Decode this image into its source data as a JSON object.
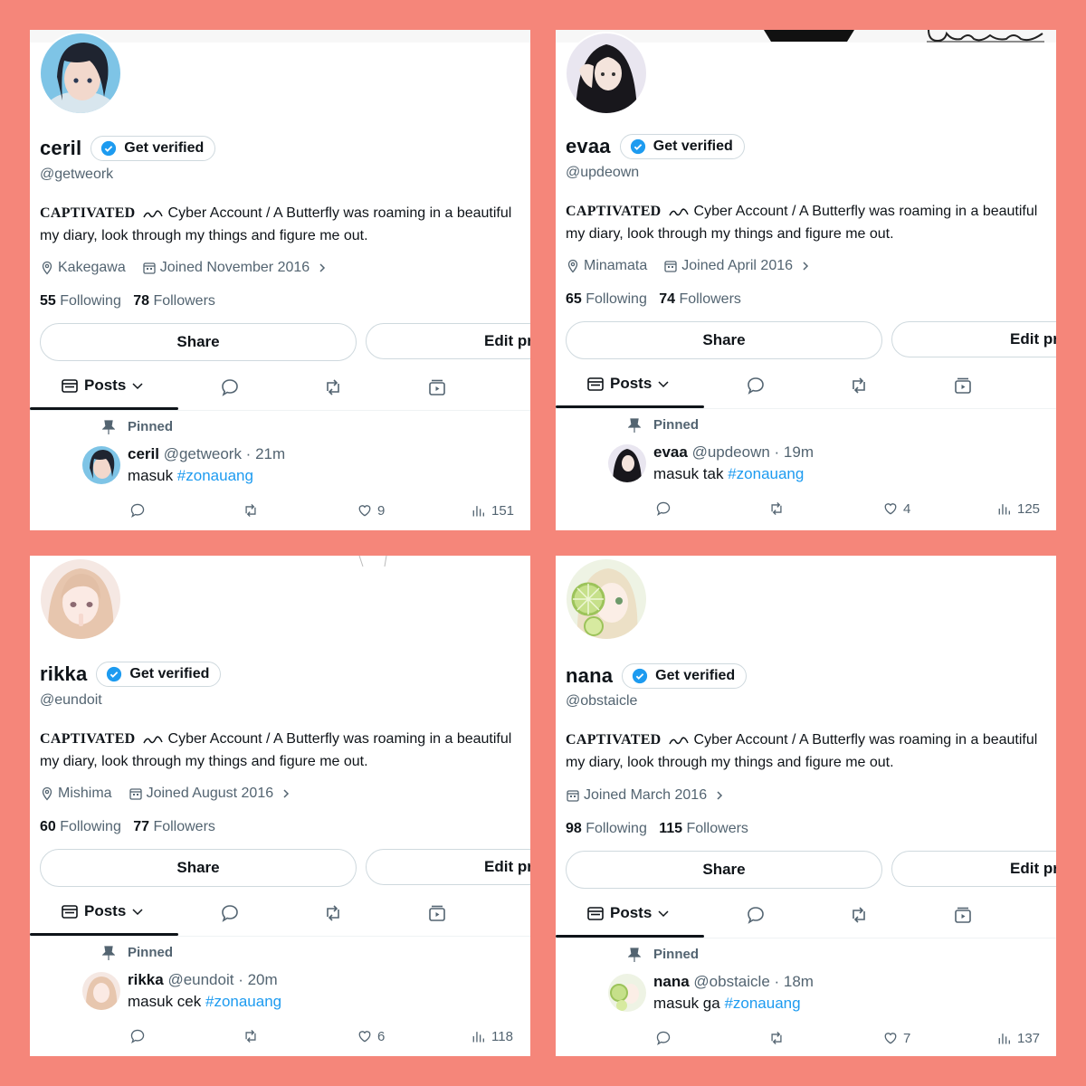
{
  "common": {
    "get_verified": "Get verified",
    "bio_captivated": "CAPTIVATED",
    "bio_line1": "Cyber Account / A Butterfly was roaming in a beautiful",
    "bio_line2": "my diary, look through my things and figure me out.",
    "following_label": "Following",
    "followers_label": "Followers",
    "share": "Share",
    "edit_profile": "Edit pr",
    "posts_tab": "Posts",
    "pinned": "Pinned",
    "hashtag": "#zonauang",
    "colors": {
      "accent": "#1d9bf0",
      "background": "#f5867a",
      "secondary_text": "#536471"
    }
  },
  "profiles": [
    {
      "name": "ceril",
      "handle": "@getweork",
      "location": "Kakegawa",
      "joined": "Joined November 2016",
      "following": "55",
      "followers": "78",
      "post_handle_time": "@getweork · 21m",
      "post_text": "masuk ",
      "likes": "9",
      "views": "151"
    },
    {
      "name": "evaa",
      "handle": "@updeown",
      "location": "Minamata",
      "joined": "Joined April 2016",
      "following": "65",
      "followers": "74",
      "post_handle_time": "@updeown · 19m",
      "post_text": "masuk tak ",
      "likes": "4",
      "views": "125"
    },
    {
      "name": "rikka",
      "handle": "@eundoit",
      "location": "Mishima",
      "joined": "Joined August 2016",
      "following": "60",
      "followers": "77",
      "post_handle_time": "@eundoit · 20m",
      "post_text": "masuk cek ",
      "likes": "6",
      "views": "118"
    },
    {
      "name": "nana",
      "handle": "@obstaicle",
      "location": "",
      "joined": "Joined March 2016",
      "following": "98",
      "followers": "115",
      "post_handle_time": "@obstaicle · 18m",
      "post_text": "masuk ga ",
      "likes": "7",
      "views": "137"
    }
  ]
}
